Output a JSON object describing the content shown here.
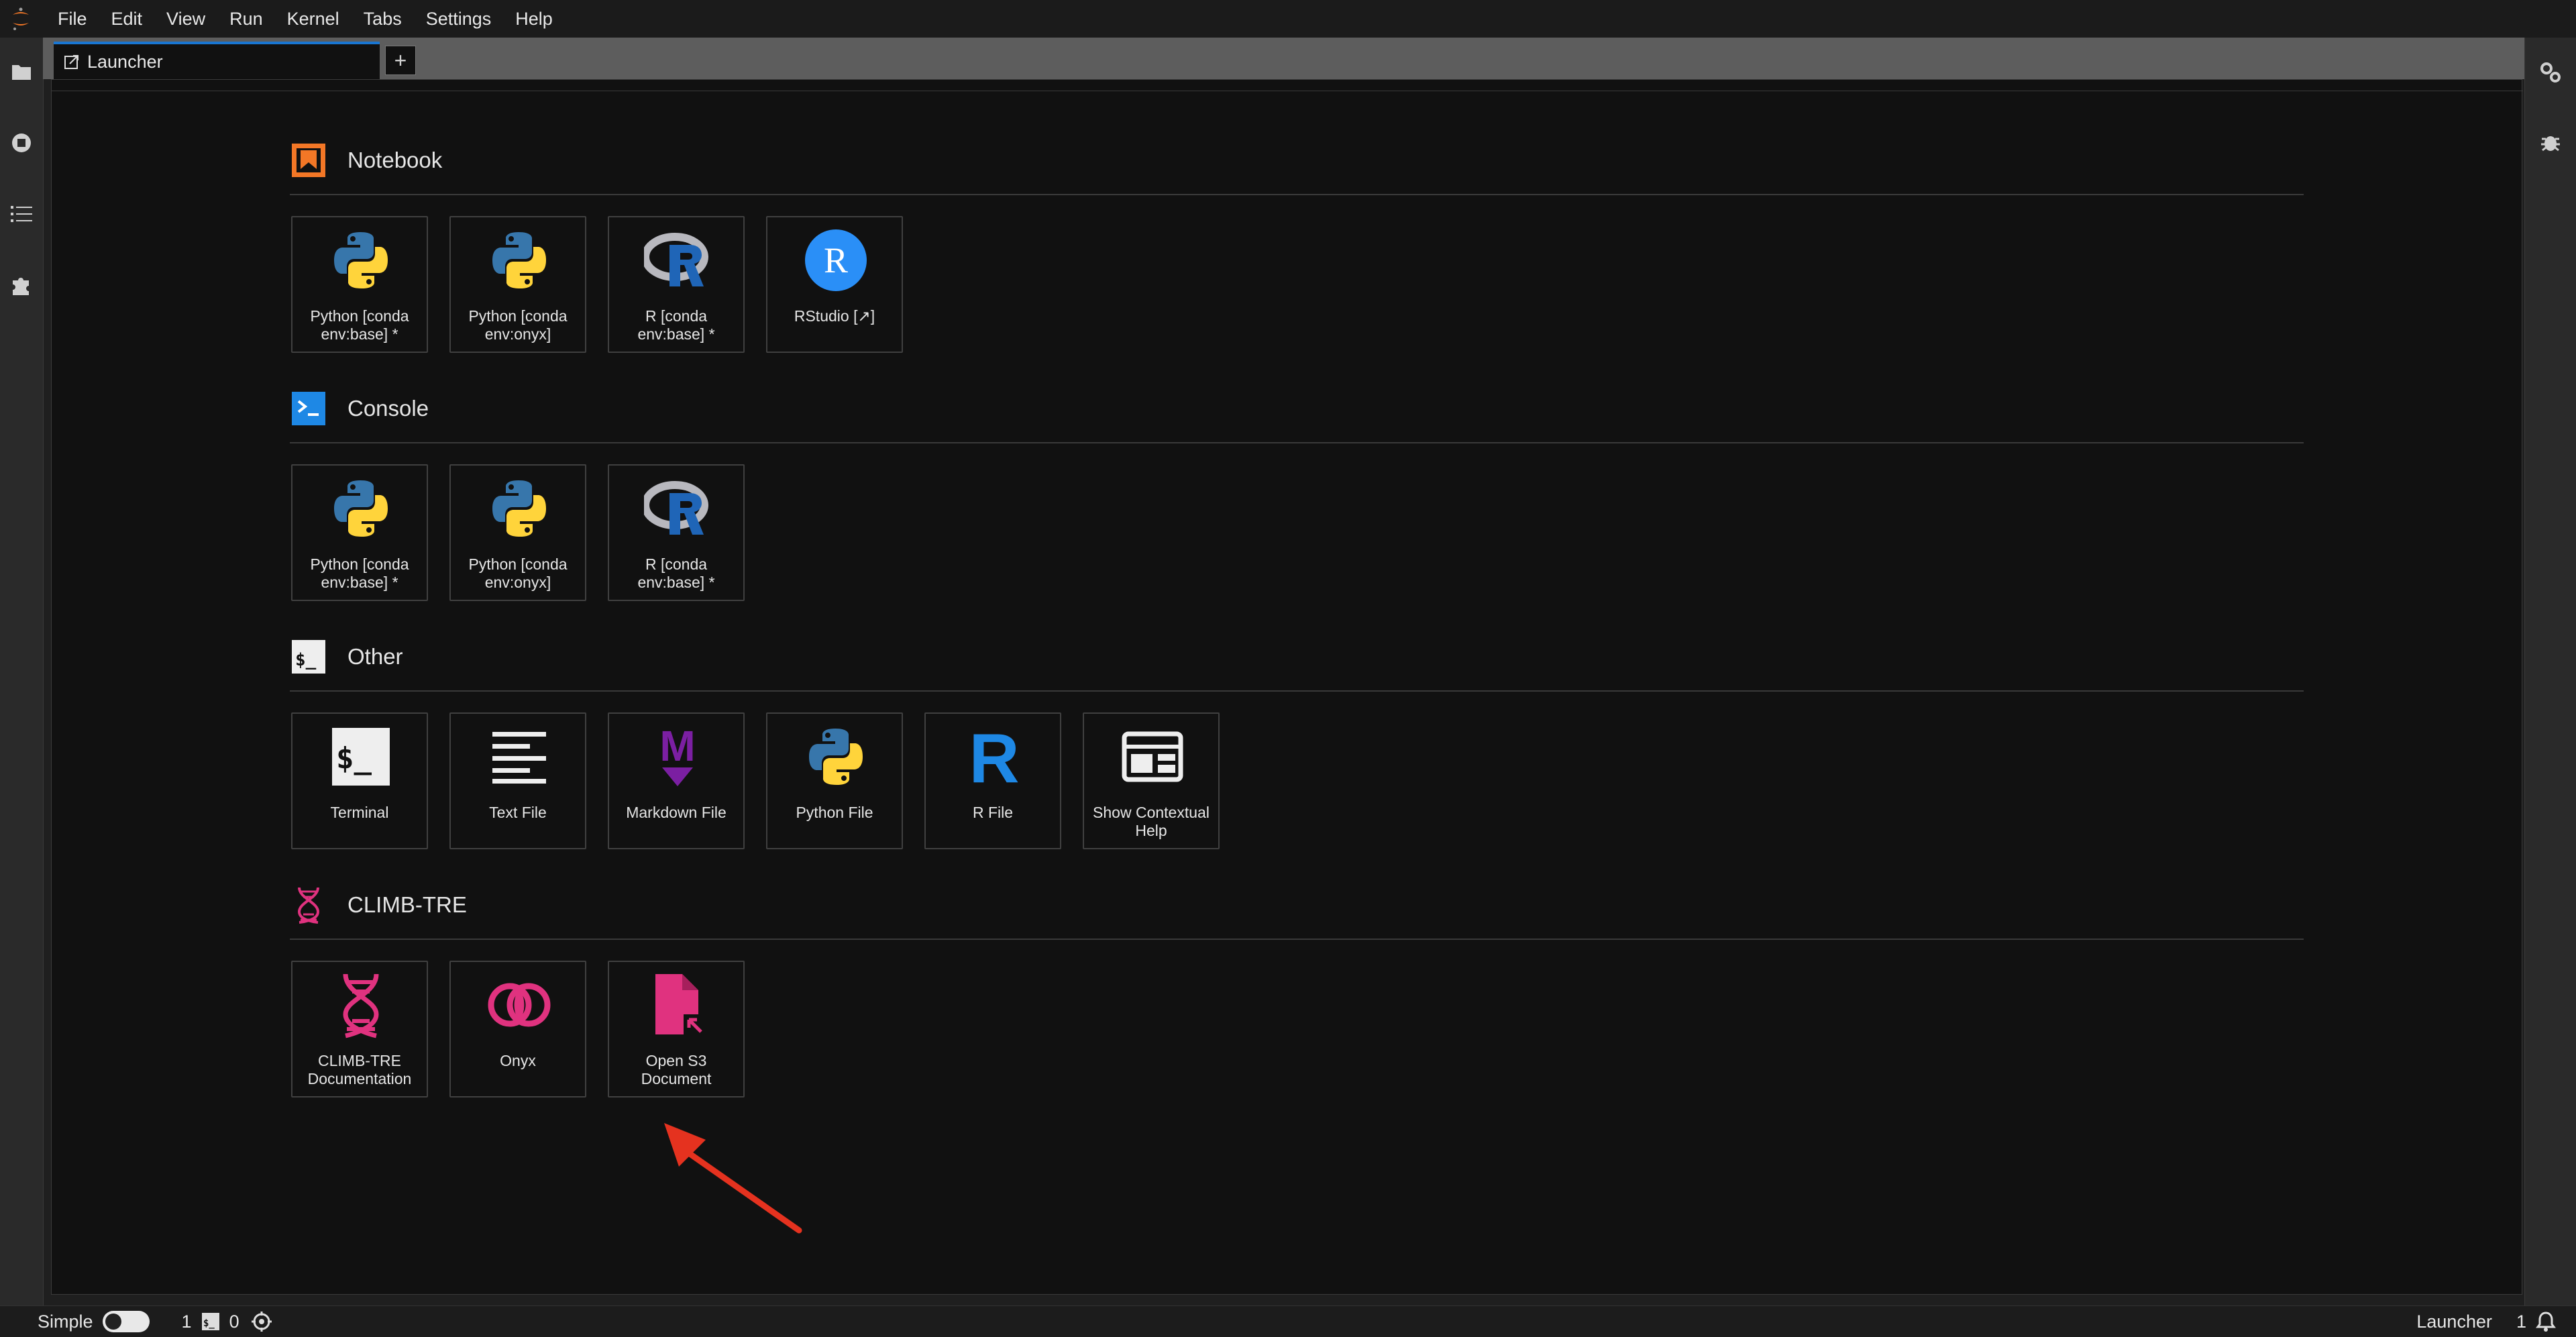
{
  "menubar": {
    "items": [
      "File",
      "Edit",
      "View",
      "Run",
      "Kernel",
      "Tabs",
      "Settings",
      "Help"
    ]
  },
  "left_sidebar_icons": [
    "folder-icon",
    "running-icon",
    "toc-icon",
    "extension-icon"
  ],
  "right_sidebar_icons": [
    "property-inspector-icon",
    "debugger-icon"
  ],
  "tabbar": {
    "active_tab": "Launcher",
    "add_label": "+"
  },
  "sections": {
    "notebook": {
      "title": "Notebook",
      "items": [
        {
          "label": "Python [conda env:base] *",
          "icon": "python-icon"
        },
        {
          "label": "Python [conda env:onyx]",
          "icon": "python-icon"
        },
        {
          "label": "R [conda env:base] *",
          "icon": "r-logo-icon"
        },
        {
          "label": "RStudio [↗]",
          "icon": "rstudio-icon"
        }
      ]
    },
    "console": {
      "title": "Console",
      "items": [
        {
          "label": "Python [conda env:base] *",
          "icon": "python-icon"
        },
        {
          "label": "Python [conda env:onyx]",
          "icon": "python-icon"
        },
        {
          "label": "R [conda env:base] *",
          "icon": "r-logo-icon"
        }
      ]
    },
    "other": {
      "title": "Other",
      "header_icon_text": "$_",
      "items": [
        {
          "label": "Terminal",
          "icon": "terminal-icon",
          "icon_text": "$_"
        },
        {
          "label": "Text File",
          "icon": "text-file-icon"
        },
        {
          "label": "Markdown File",
          "icon": "markdown-icon",
          "icon_text": "M"
        },
        {
          "label": "Python File",
          "icon": "python-icon"
        },
        {
          "label": "R File",
          "icon": "r-file-icon",
          "icon_text": "R"
        },
        {
          "label": "Show Contextual Help",
          "icon": "contextual-help-icon"
        }
      ]
    },
    "climb": {
      "title": "CLIMB-TRE",
      "items": [
        {
          "label": "CLIMB-TRE Documentation",
          "icon": "dna-icon"
        },
        {
          "label": "Onyx",
          "icon": "onyx-icon"
        },
        {
          "label": "Open S3 Document",
          "icon": "s3-document-icon"
        }
      ]
    }
  },
  "statusbar": {
    "mode_label": "Simple",
    "terminals_count": "1",
    "terminal_icon_text": "$_",
    "kernels_count": "0",
    "current_activity": "Launcher",
    "notifications_count": "1"
  },
  "colors": {
    "accent_blue": "#1976d2",
    "notebook_orange": "#f37726",
    "climb_pink": "#e0327f",
    "annotation_arrow": "#e5321f",
    "markdown_purple": "#7b1fa2"
  }
}
